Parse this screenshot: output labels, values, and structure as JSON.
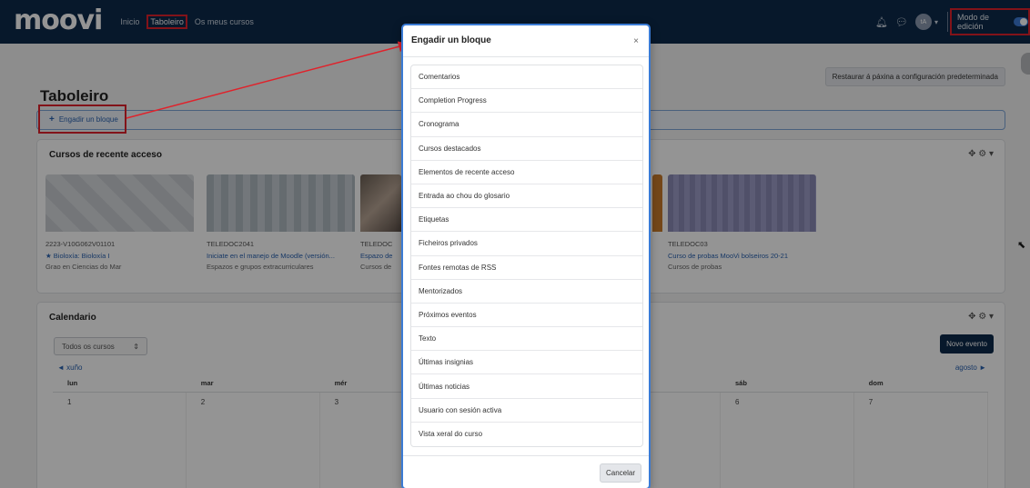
{
  "navbar": {
    "logo": "moovi",
    "links": [
      "Inicio",
      "Taboleiro",
      "Os meus cursos"
    ],
    "avatar_initials": "tA",
    "edit_mode_label": "Modo de edición"
  },
  "page": {
    "restore_button": "Restaurar á páxina a configuración predeterminada",
    "title": "Taboleiro",
    "add_block_label": "Engadir un bloque"
  },
  "recent": {
    "title": "Cursos de recente acceso",
    "courses": [
      {
        "code": "2223-V10G062V01101",
        "name": "★ Bioloxía: Bioloxía I",
        "category": "Grao en Ciencias do Mar"
      },
      {
        "code": "TELEDOC2041",
        "name": "Iniciate en el manejo de Moodle (versión...",
        "category": "Espazos e grupos extracurriculares"
      },
      {
        "code": "TELEDOC",
        "name": "Espazo de",
        "category": "Cursos de"
      },
      {
        "code": "TELEDOC03",
        "name": "Curso de probas MooVi bolseiros 20-21",
        "category": "Cursos de probas"
      }
    ]
  },
  "calendar": {
    "title": "Calendario",
    "filter": "Todos os cursos",
    "new_event": "Novo evento",
    "prev_month": "◄ xuño",
    "next_month": "agosto ►",
    "days": [
      "lun",
      "mar",
      "mér",
      "",
      "",
      "sáb",
      "dom"
    ],
    "dates": [
      "1",
      "2",
      "3",
      "",
      "",
      "6",
      "7"
    ]
  },
  "modal": {
    "title": "Engadir un bloque",
    "close": "×",
    "items": [
      "Comentarios",
      "Completion Progress",
      "Cronograma",
      "Cursos destacados",
      "Elementos de recente acceso",
      "Entrada ao chou do glosario",
      "Etiquetas",
      "Ficheiros privados",
      "Fontes remotas de RSS",
      "Mentorizados",
      "Próximos eventos",
      "Texto",
      "Últimas insignias",
      "Últimas noticias",
      "Usuario con sesión activa",
      "Vista xeral do curso"
    ],
    "cancel": "Cancelar"
  },
  "colors": {
    "navbar": "#0d2a4a",
    "highlight": "#e0222b",
    "link": "#2a62b0",
    "modal_border": "#3a7bd5"
  }
}
